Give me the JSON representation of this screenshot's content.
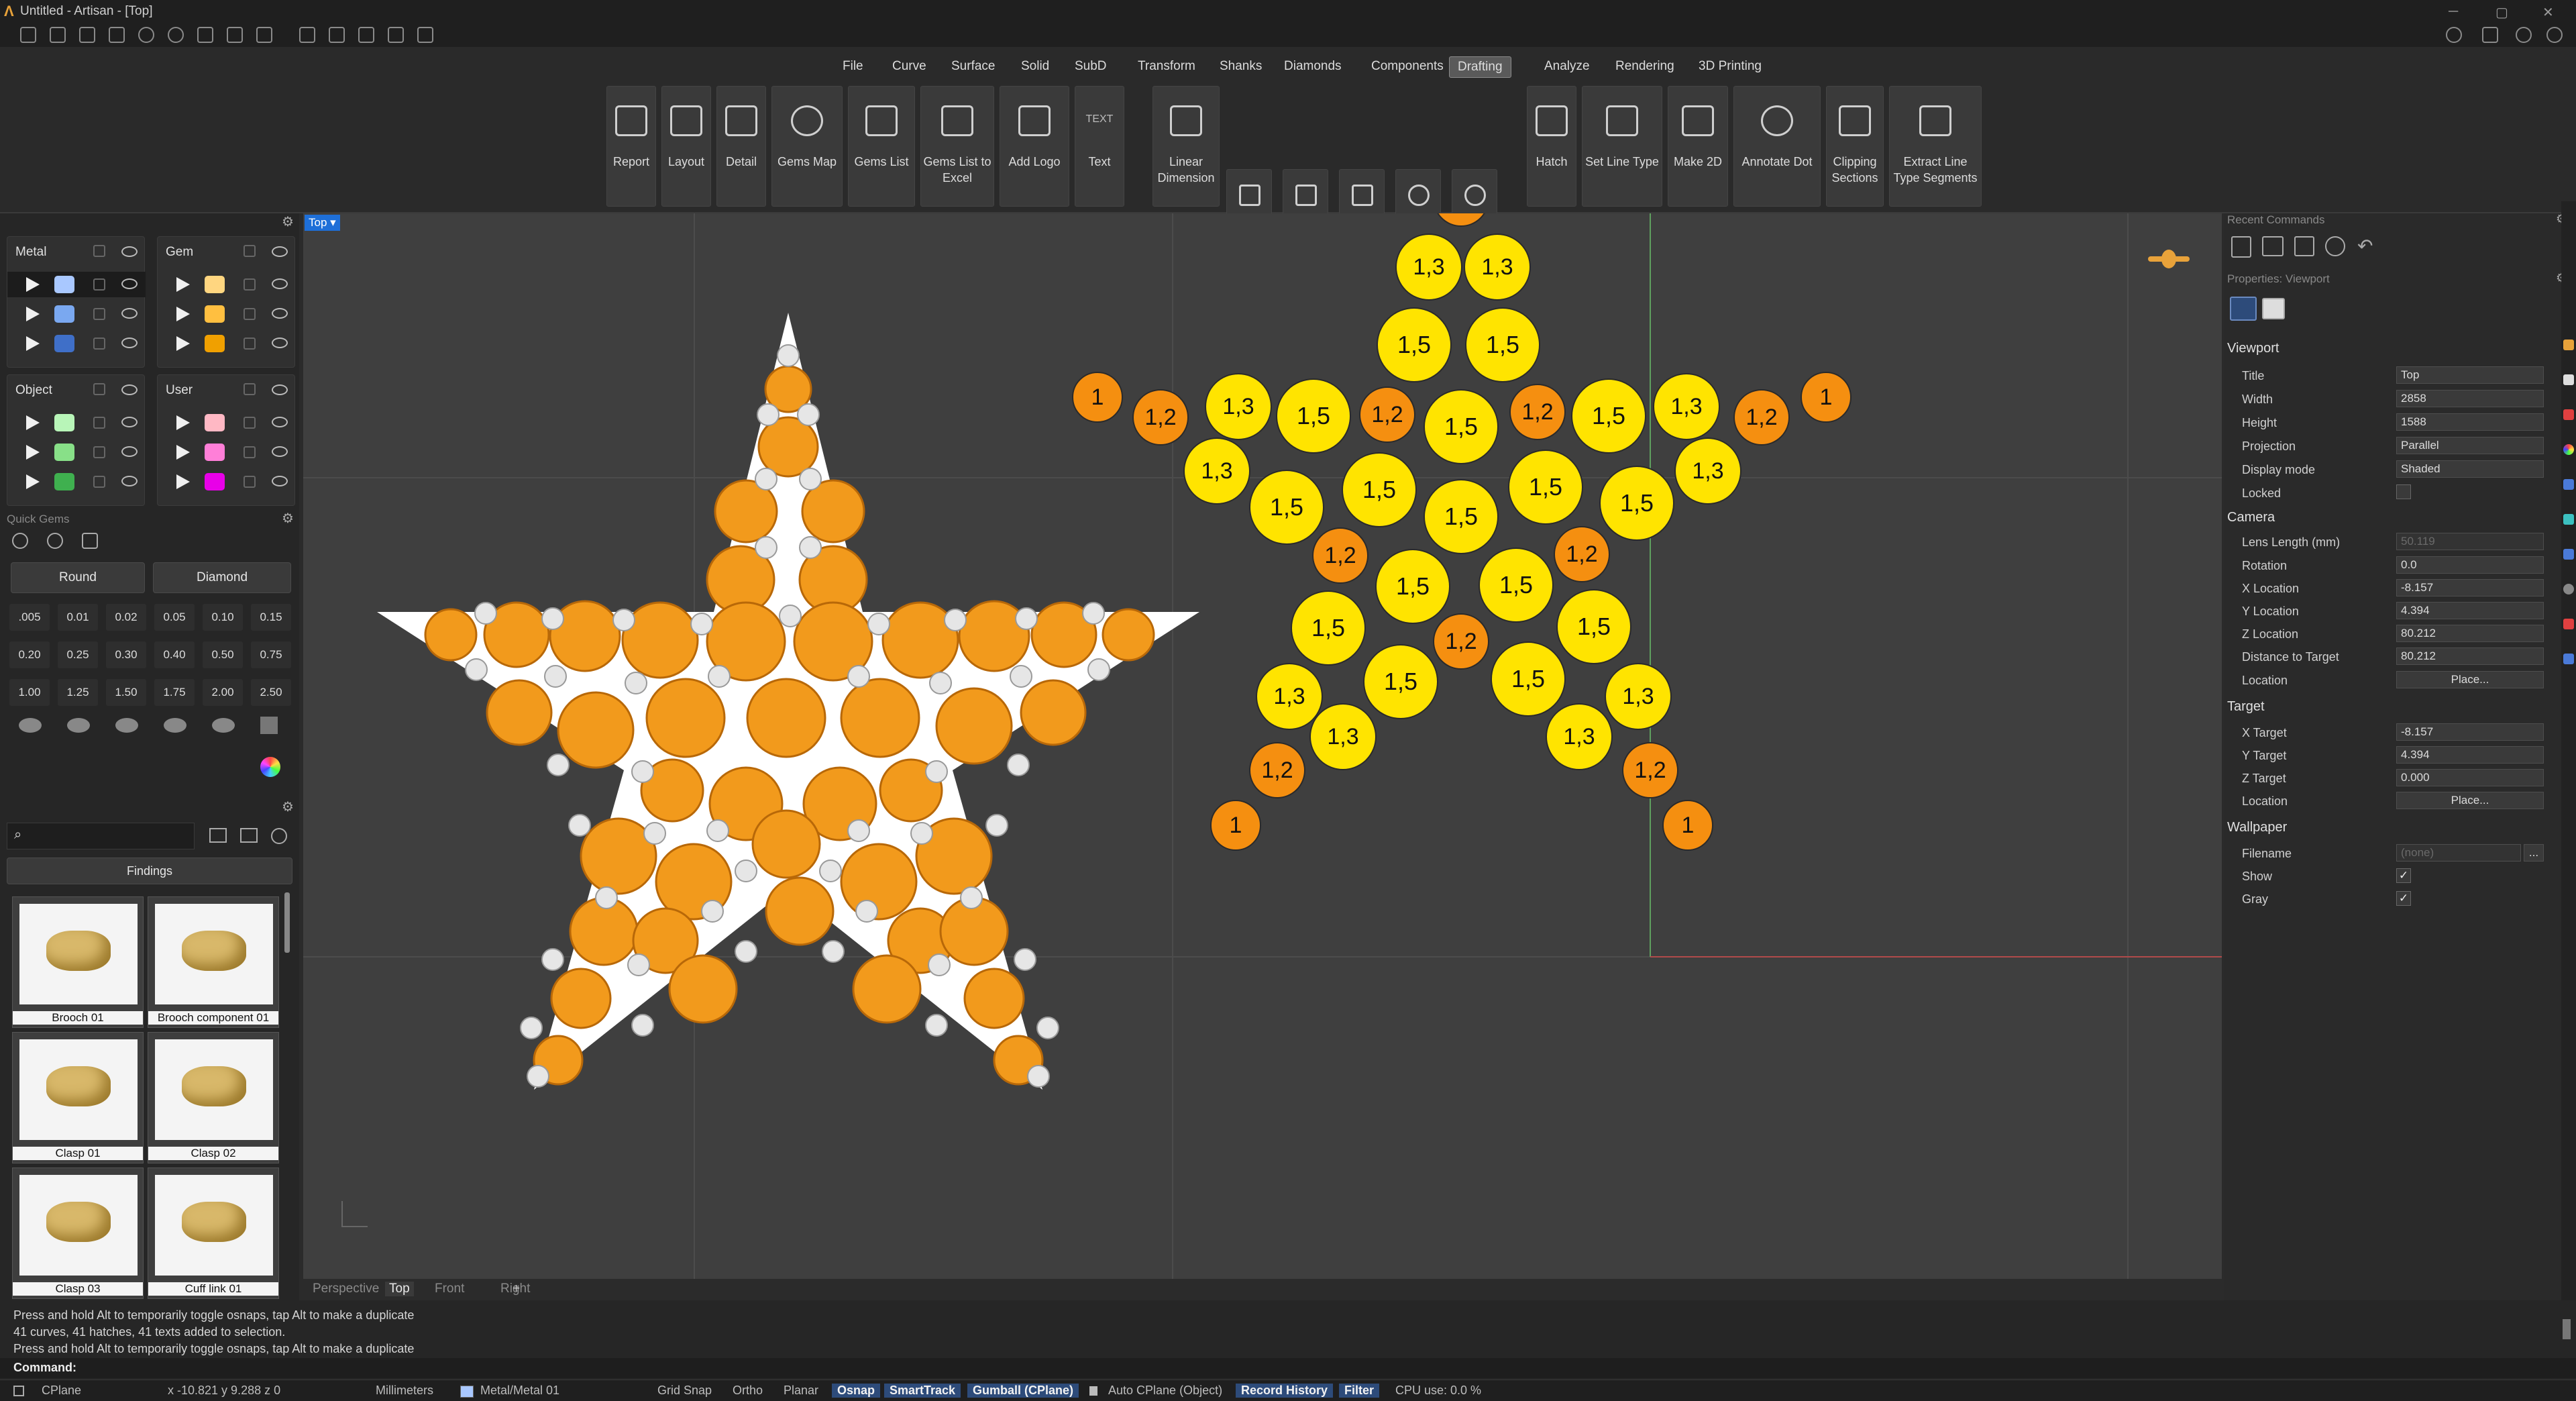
{
  "window": {
    "title": "Untitled - Artisan - [Top]"
  },
  "menu": [
    "File",
    "Curve",
    "Surface",
    "Solid",
    "SubD",
    "Transform",
    "Shanks",
    "Diamonds",
    "Components",
    "Drafting",
    "Analyze",
    "Rendering",
    "3D Printing"
  ],
  "menu_active": "Drafting",
  "ribbon": {
    "report": "Report",
    "layout": "Layout",
    "detail": "Detail",
    "gems_map": "Gems Map",
    "gems_list": "Gems List",
    "gems_excel_1": "Gems List to",
    "gems_excel_2": "Excel",
    "add_logo": "Add Logo",
    "text": "Text",
    "text_icon": "TEXT",
    "lin_dim_1": "Linear",
    "lin_dim_2": "Dimension",
    "hatch": "Hatch",
    "set_line_type": "Set Line Type",
    "make2d": "Make 2D",
    "annotate_dot": "Annotate Dot",
    "clip_1": "Clipping",
    "clip_2": "Sections",
    "extract_1": "Extract Line",
    "extract_2": "Type Segments"
  },
  "layers": {
    "metal": {
      "title": "Metal",
      "colors": [
        "#a9c8ff",
        "#7aa8f0",
        "#3f6fc8"
      ]
    },
    "gem": {
      "title": "Gem",
      "colors": [
        "#ffd680",
        "#ffbf40",
        "#f0a000"
      ]
    },
    "object": {
      "title": "Object",
      "colors": [
        "#b8f5b8",
        "#88e088",
        "#3fb04f"
      ]
    },
    "user": {
      "title": "User",
      "colors": [
        "#ffb8c4",
        "#ff7fd8",
        "#e800e8"
      ]
    }
  },
  "quick_gems": {
    "title": "Quick Gems",
    "shape": "Round",
    "material": "Diamond",
    "sizes": [
      ".005",
      "0.01",
      "0.02",
      "0.05",
      "0.10",
      "0.15",
      "0.20",
      "0.25",
      "0.30",
      "0.40",
      "0.50",
      "0.75",
      "1.00",
      "1.25",
      "1.50",
      "1.75",
      "2.00",
      "2.50"
    ]
  },
  "library": {
    "search_placeholder": "",
    "category": "Findings",
    "items": [
      "Brooch 01",
      "Brooch component 01",
      "Clasp 01",
      "Clasp 02",
      "Clasp 03",
      "Cuff link 01"
    ]
  },
  "viewport": {
    "label": "Top",
    "tabs": [
      "Perspective",
      "Top",
      "Front",
      "Right"
    ],
    "add": "+"
  },
  "gems_map": [
    {
      "label": "1",
      "size": "s"
    },
    {
      "label": "1,2",
      "size": "m"
    },
    {
      "label": "1,3",
      "size": "l"
    },
    {
      "label": "1,5",
      "size": "xl"
    }
  ],
  "right": {
    "recent_title": "Recent Commands",
    "props_title": "Properties: Viewport",
    "sec_viewport": "Viewport",
    "sec_camera": "Camera",
    "sec_target": "Target",
    "sec_wallpaper": "Wallpaper",
    "title_l": "Title",
    "title_v": "Top",
    "width_l": "Width",
    "width_v": "2858",
    "height_l": "Height",
    "height_v": "1588",
    "proj_l": "Projection",
    "proj_v": "Parallel",
    "disp_l": "Display mode",
    "disp_v": "Shaded",
    "locked_l": "Locked",
    "lens_l": "Lens Length (mm)",
    "lens_v": "50.119",
    "rot_l": "Rotation",
    "rot_v": "0.0",
    "xloc_l": "X Location",
    "xloc_v": "-8.157",
    "yloc_l": "Y Location",
    "yloc_v": "4.394",
    "zloc_l": "Z Location",
    "zloc_v": "80.212",
    "dist_l": "Distance to Target",
    "dist_v": "80.212",
    "loc_l": "Location",
    "place": "Place...",
    "xt_l": "X Target",
    "xt_v": "-8.157",
    "yt_l": "Y Target",
    "yt_v": "4.394",
    "zt_l": "Z Target",
    "zt_v": "0.000",
    "tloc_l": "Location",
    "file_l": "Filename",
    "file_v": "(none)",
    "show_l": "Show",
    "gray_l": "Gray",
    "check": "✓",
    "more": "..."
  },
  "command": {
    "lines": [
      "Press and hold Alt to temporarily toggle osnaps, tap Alt to make a duplicate",
      "41 curves, 41 hatches, 41 texts added to selection.",
      "Press and hold Alt to temporarily toggle osnaps, tap Alt to make a duplicate"
    ],
    "prompt": "Command:"
  },
  "status": {
    "cplane": "CPlane",
    "coords": "x -10.821  y 9.288  z 0",
    "units": "Millimeters",
    "layer": "Metal/Metal 01",
    "grid": "Grid Snap",
    "ortho": "Ortho",
    "planar": "Planar",
    "osnap": "Osnap",
    "smarttrack": "SmartTrack",
    "gumball": "Gumball (CPlane)",
    "autocplane": "Auto CPlane (Object)",
    "history": "Record History",
    "filter": "Filter",
    "cpu": "CPU use: 0.0 %"
  }
}
